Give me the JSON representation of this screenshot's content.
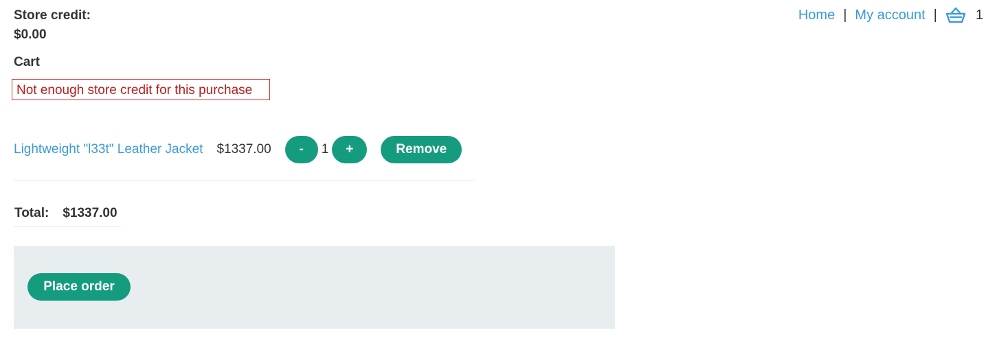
{
  "header": {
    "store_credit_label": "Store credit:",
    "store_credit_value": "$0.00",
    "cart_heading": "Cart"
  },
  "nav": {
    "home": "Home",
    "separator": "|",
    "my_account": "My account",
    "cart_icon": "shopping-basket-icon",
    "cart_count": "1"
  },
  "error": {
    "message": "Not enough store credit for this purchase"
  },
  "cart": {
    "items": [
      {
        "name": "Lightweight \"l33t\" Leather Jacket",
        "price": "$1337.00",
        "minus_label": "-",
        "quantity": "1",
        "plus_label": "+",
        "remove_label": "Remove"
      }
    ]
  },
  "total": {
    "label": "Total:",
    "value": "$1337.00"
  },
  "order": {
    "place_order_label": "Place order"
  },
  "colors": {
    "accent": "#159c7f",
    "link": "#3a9bd6",
    "error": "#b71c1c",
    "panel_bg": "#e8eef0"
  }
}
